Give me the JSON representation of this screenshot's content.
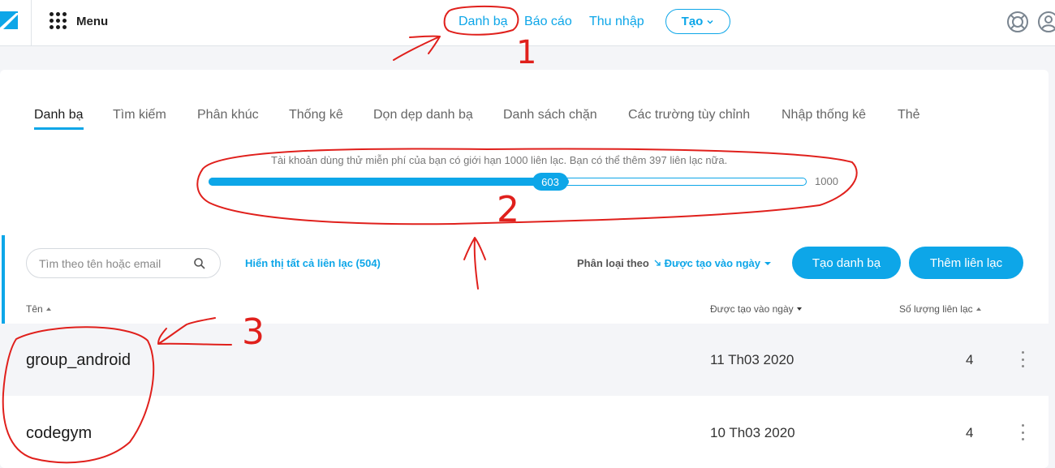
{
  "topbar": {
    "menu_label": "Menu",
    "nav": [
      "Danh bạ",
      "Báo cáo",
      "Thu nhập"
    ],
    "create_label": "Tạo",
    "brand_color": "#0da6e8"
  },
  "tabs": [
    "Danh bạ",
    "Tìm kiếm",
    "Phân khúc",
    "Thống kê",
    "Dọn dẹp danh bạ",
    "Danh sách chặn",
    "Các trường tùy chỉnh",
    "Nhập thống kê",
    "Thẻ"
  ],
  "limit": {
    "text": "Tài khoản dùng thử miễn phí của bạn có giới hạn 1000 liên lạc. Bạn có thể thêm 397 liên lạc nữa.",
    "used": "603",
    "max": "1000",
    "fraction": 0.603
  },
  "toolbar": {
    "search_placeholder": "Tìm theo tên hoặc email",
    "show_all": "Hiển thị tất cả liên lạc (504)",
    "sort_label": "Phân loại theo",
    "sort_value": "Được tạo vào ngày",
    "create_list": "Tạo danh bạ",
    "add_contact": "Thêm liên lạc"
  },
  "table": {
    "headers": [
      "Tên",
      "Được tạo vào ngày",
      "Số lượng liên lạc"
    ],
    "rows": [
      {
        "name": "group_android",
        "date": "11 Th03 2020",
        "count": "4"
      },
      {
        "name": "codegym",
        "date": "10 Th03 2020",
        "count": "4"
      }
    ]
  },
  "annotations": [
    "1",
    "2",
    "3"
  ]
}
